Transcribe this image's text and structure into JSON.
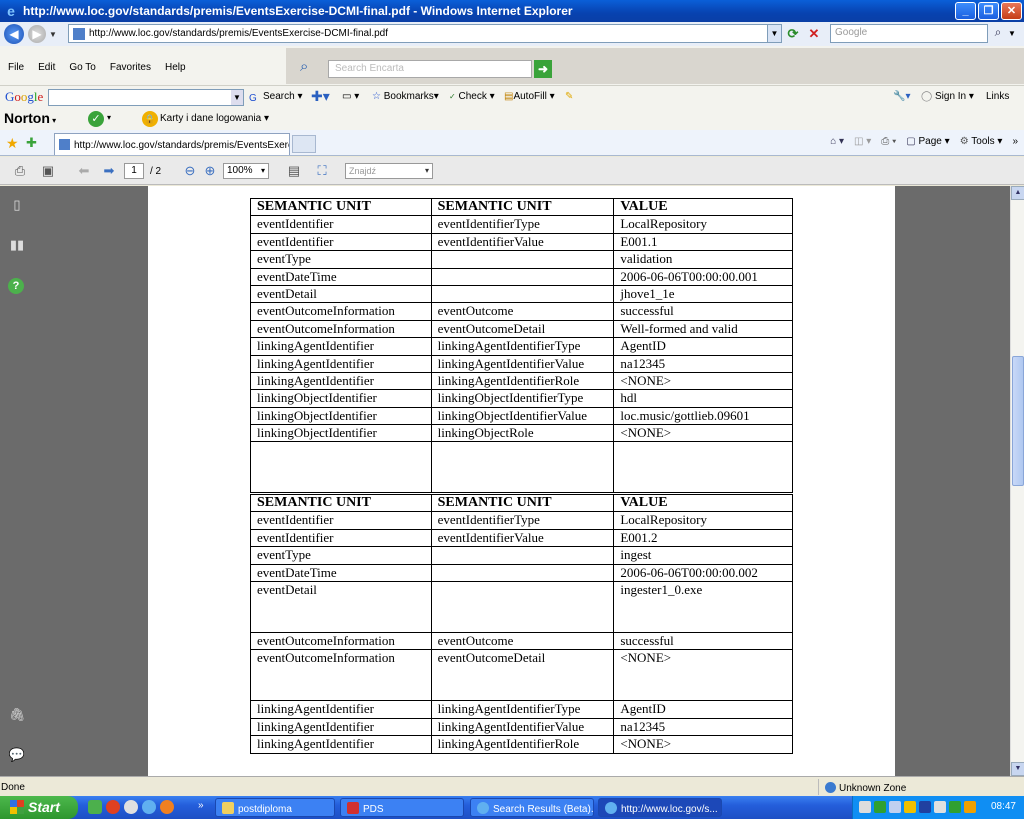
{
  "window": {
    "title": "http://www.loc.gov/standards/premis/EventsExercise-DCMI-final.pdf - Windows Internet Explorer"
  },
  "address_bar": {
    "url": "http://www.loc.gov/standards/premis/EventsExercise-DCMI-final.pdf",
    "search_placeholder": "Google"
  },
  "menu": {
    "items": [
      "File",
      "Edit",
      "Go To",
      "Favorites",
      "Help"
    ],
    "encarta_placeholder": "Search Encarta"
  },
  "google_toolbar": {
    "search_label": "Search",
    "bookmarks_label": "Bookmarks",
    "check_label": "Check",
    "autofill_label": "AutoFill",
    "signin_label": "Sign In",
    "links_label": "Links"
  },
  "norton_toolbar": {
    "brand": "Norton",
    "karty_label": "Karty i dane logowania"
  },
  "tabs": {
    "active_title": "http://www.loc.gov/standards/premis/EventsExercise...",
    "page_label": "Page",
    "tools_label": "Tools"
  },
  "pdf_toolbar": {
    "current_page": "1",
    "total_pages": "/ 2",
    "zoom": "100%",
    "find_placeholder": "Znajdź"
  },
  "document": {
    "header": [
      "SEMANTIC UNIT",
      "SEMANTIC UNIT",
      "VALUE"
    ],
    "table1": [
      [
        "eventIdentifier",
        "eventIdentifierType",
        "LocalRepository"
      ],
      [
        "eventIdentifier",
        "eventIdentifierValue",
        "E001.1"
      ],
      [
        "eventType",
        "",
        "validation"
      ],
      [
        "eventDateTime",
        "",
        "2006-06-06T00:00:00.001"
      ],
      [
        "eventDetail",
        "",
        "jhove1_1e"
      ],
      [
        "eventOutcomeInformation",
        "eventOutcome",
        "successful"
      ],
      [
        "eventOutcomeInformation",
        "eventOutcomeDetail",
        "Well-formed and valid"
      ],
      [
        "linkingAgentIdentifier",
        "linkingAgentIdentifierType",
        "AgentID"
      ],
      [
        "linkingAgentIdentifier",
        "linkingAgentIdentifierValue",
        "na12345"
      ],
      [
        "linkingAgentIdentifier",
        "linkingAgentIdentifierRole",
        "<NONE>"
      ],
      [
        "linkingObjectIdentifier",
        "linkingObjectIdentifierType",
        "hdl"
      ],
      [
        "linkingObjectIdentifier",
        "linkingObjectIdentifierValue",
        "loc.music/gottlieb.09601"
      ],
      [
        "linkingObjectIdentifier",
        "linkingObjectRole",
        "<NONE>"
      ]
    ],
    "table2": [
      [
        "eventIdentifier",
        "eventIdentifierType",
        "LocalRepository"
      ],
      [
        "eventIdentifier",
        "eventIdentifierValue",
        "E001.2"
      ],
      [
        "eventType",
        "",
        "ingest"
      ],
      [
        "eventDateTime",
        "",
        "2006-06-06T00:00:00.002"
      ],
      [
        "eventDetail",
        "",
        "ingester1_0.exe"
      ],
      [
        "eventOutcomeInformation",
        "eventOutcome",
        "successful"
      ],
      [
        "eventOutcomeInformation",
        "eventOutcomeDetail",
        "<NONE>"
      ],
      [
        "linkingAgentIdentifier",
        "linkingAgentIdentifierType",
        "AgentID"
      ],
      [
        "linkingAgentIdentifier",
        "linkingAgentIdentifierValue",
        "na12345"
      ],
      [
        "linkingAgentIdentifier",
        "linkingAgentIdentifierRole",
        "<NONE>"
      ]
    ]
  },
  "status_bar": {
    "left": "Done",
    "zone": "Unknown Zone"
  },
  "taskbar": {
    "start_label": "Start",
    "items": [
      "postdiploma",
      "PDS",
      "Search Results (Beta)...",
      "http://www.loc.gov/s..."
    ],
    "clock": "08:47"
  }
}
